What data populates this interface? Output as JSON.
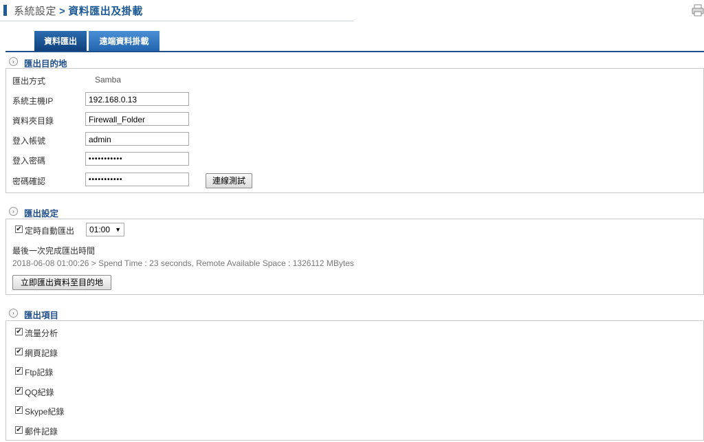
{
  "header": {
    "section": "系統設定",
    "separator": ">",
    "current": "資料匯出及掛載"
  },
  "icons": {
    "printer": "printer-icon",
    "section_bullet": "circle-arrow-icon"
  },
  "tabs": [
    {
      "label": "資料匯出",
      "active": true
    },
    {
      "label": "遠端資料掛載",
      "active": false
    }
  ],
  "destination": {
    "title": "匯出目的地",
    "method_label": "匯出方式",
    "method_value": "Samba",
    "host_label": "系統主機IP",
    "host_value": "192.168.0.13",
    "folder_label": "資料夾目錄",
    "folder_value": "Firewall_Folder",
    "account_label": "登入帳號",
    "account_value": "admin",
    "password_label": "登入密碼",
    "password_value": "•••••••••••",
    "confirm_label": "密碼確認",
    "confirm_value": "•••••••••••",
    "test_button": "連線測試"
  },
  "settings": {
    "title": "匯出設定",
    "auto_label": "定時自動匯出",
    "auto_checked": true,
    "time_value": "01:00",
    "last_label": "最後一次完成匯出時間",
    "last_value": "2018-06-08 01:00:26 > Spend Time : 23 seconds, Remote Available Space : 1326112 MBytes",
    "export_now_button": "立即匯出資料至目的地"
  },
  "items": {
    "title": "匯出項目",
    "list": [
      {
        "label": "流量分析",
        "checked": true
      },
      {
        "label": "網頁記錄",
        "checked": true
      },
      {
        "label": "Ftp記錄",
        "checked": true
      },
      {
        "label": "QQ紀錄",
        "checked": true
      },
      {
        "label": "Skype紀錄",
        "checked": true
      },
      {
        "label": "郵件記錄",
        "checked": true
      }
    ]
  }
}
